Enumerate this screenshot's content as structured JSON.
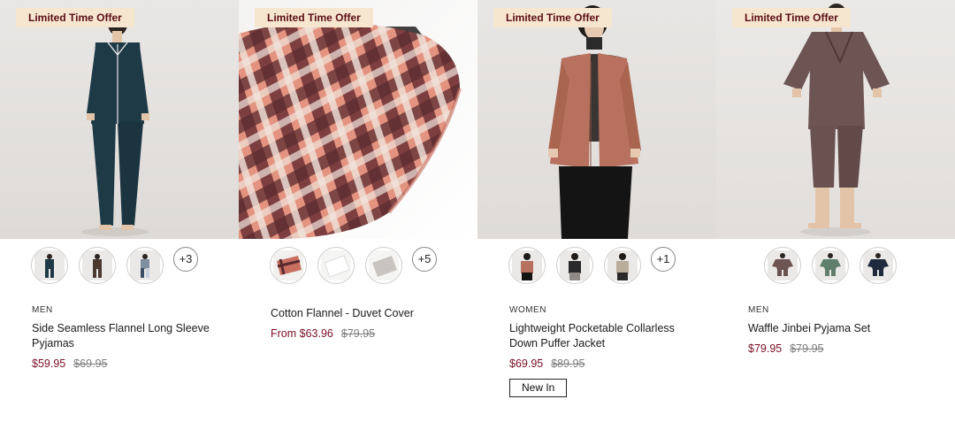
{
  "products": [
    {
      "badge": "Limited Time Offer",
      "category": "MEN",
      "name": "Side Seamless Flannel Long Sleeve Pyjamas",
      "price_now": "$59.95",
      "price_was": "$69.95",
      "more_colors": "+3"
    },
    {
      "badge": "Limited Time Offer",
      "category": "",
      "name": "Cotton Flannel - Duvet Cover",
      "price_now": "From $63.96",
      "price_was": "$79.95",
      "more_colors": "+5"
    },
    {
      "badge": "Limited Time Offer",
      "category": "WOMEN",
      "name": "Lightweight Pocketable Collarless Down Puffer Jacket",
      "price_now": "$69.95",
      "price_was": "$89.95",
      "more_colors": "+1",
      "tag": "New In"
    },
    {
      "badge": "Limited Time Offer",
      "category": "MEN",
      "name": "Waffle Jinbei Pyjama Set",
      "price_now": "$79.95",
      "price_was": "$79.95"
    }
  ],
  "colors": {
    "badge_bg": "#f7e6cf",
    "badge_text": "#5a0d17",
    "sale_price": "#7a1023",
    "old_price": "#7d7d7d"
  }
}
